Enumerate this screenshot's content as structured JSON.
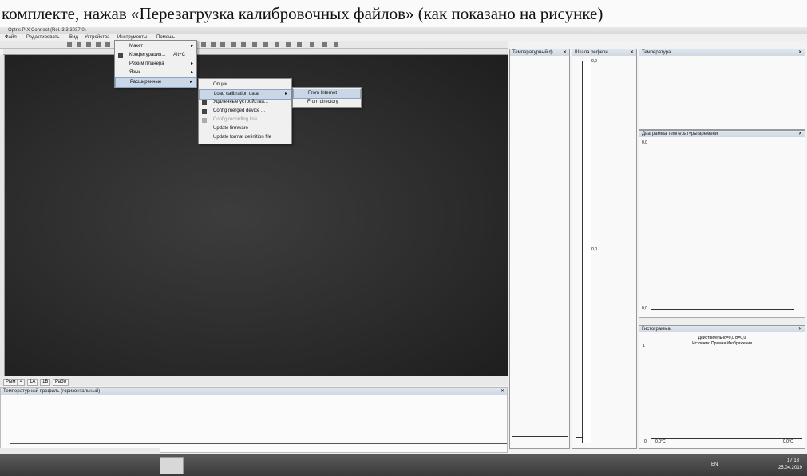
{
  "caption": "комплекте, нажав «Перезагрузка калибровочных файлов» (как показано на рисунке)",
  "window": {
    "title": "Optris PIX Connect (Rel. 3.3.3037.0)"
  },
  "menubar": [
    "Файл",
    "Редактировать",
    "Вид",
    "Устройства",
    "Инструменты",
    "Помощь"
  ],
  "tools_menu": {
    "items": [
      {
        "label": "Макет",
        "arrow": "▸"
      },
      {
        "label": "Конфигурация...",
        "shortcut": "Alt+C"
      },
      {
        "label": "Режим планера",
        "arrow": "▸"
      },
      {
        "label": "Язык",
        "arrow": "▸"
      },
      {
        "label": "Расширенные",
        "arrow": "▸"
      }
    ]
  },
  "ext_menu": {
    "items": [
      {
        "label": "Опции..."
      },
      {
        "label": "Load calibration data",
        "arrow": "▸"
      },
      {
        "label": "Удаленные устройства..."
      },
      {
        "label": "Config merged device ..."
      },
      {
        "label": "Config recording line..."
      },
      {
        "label": "Update firmware"
      },
      {
        "label": "Update format definition file"
      }
    ]
  },
  "load_menu": {
    "items": [
      {
        "label": "From Internet"
      },
      {
        "label": "From directory"
      }
    ]
  },
  "tabs": [
    "Рым",
    "4",
    "1А",
    "1В",
    "Рабо"
  ],
  "panels": {
    "bottom": "Температурный профиль (горизонтальный)",
    "temp_small": "Температурный ф",
    "ref": "Шкала реферн",
    "temperature": "Температура",
    "diagram": "Диаграмма температуры времени",
    "histogram": "Гистограмма"
  },
  "ref_scale": {
    "top": "0,0",
    "mid": "0,0"
  },
  "diagram_axis": {
    "top": "0,0",
    "bottom": "0,0"
  },
  "hist_text": {
    "line1": "Действительно=0,0 B=0,0",
    "line2": "Источник: Прямая Изображения",
    "y": "1",
    "x0": "0",
    "x1": "0,0°C",
    "x2": "0,0°C"
  },
  "tray": {
    "lang": "EN",
    "time": "17:18",
    "date": "25.04.2019"
  }
}
